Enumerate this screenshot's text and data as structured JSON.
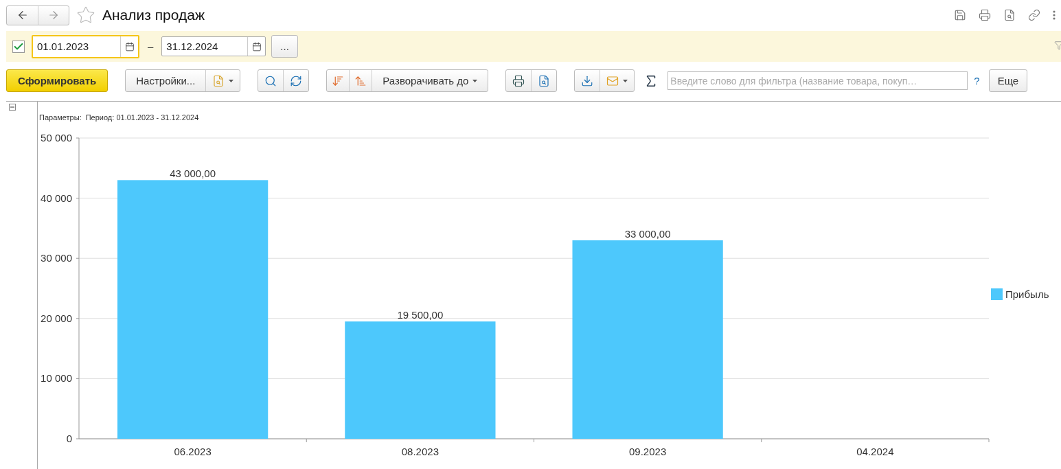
{
  "window": {
    "title": "Анализ продаж",
    "favorite": false
  },
  "period": {
    "enabled": true,
    "start": "01.01.2023",
    "separator": "–",
    "end": "31.12.2024",
    "more_button": "..."
  },
  "toolbar": {
    "generate": "Сформировать",
    "settings": "Настройки...",
    "expand": "Разворачивать до",
    "filter": {
      "placeholder": "Введите слово для фильтра (название товара, покуп…"
    },
    "help": "?",
    "more": "Еще"
  },
  "report": {
    "expanded": true,
    "parameters_label": "Параметры:",
    "parameters_value": "Период: 01.01.2023 - 31.12.2024",
    "chart_data": {
      "type": "bar",
      "categories": [
        "06.2023",
        "08.2023",
        "09.2023",
        "04.2024"
      ],
      "series": [
        {
          "name": "Прибыль",
          "color": "#4dc8fc",
          "values": [
            43000,
            19500,
            33000,
            null
          ]
        }
      ],
      "ylim": [
        0,
        50000
      ],
      "grid": true,
      "yticks": [
        {
          "value": 0,
          "label": "0"
        },
        {
          "value": 10000,
          "label": "10 000"
        },
        {
          "value": 20000,
          "label": "20 000"
        },
        {
          "value": 30000,
          "label": "30 000"
        },
        {
          "value": 40000,
          "label": "40 000"
        },
        {
          "value": 50000,
          "label": "50 000"
        }
      ],
      "value_labels": [
        "43 000,00",
        "19 500,00",
        "33 000,00",
        null
      ]
    }
  }
}
